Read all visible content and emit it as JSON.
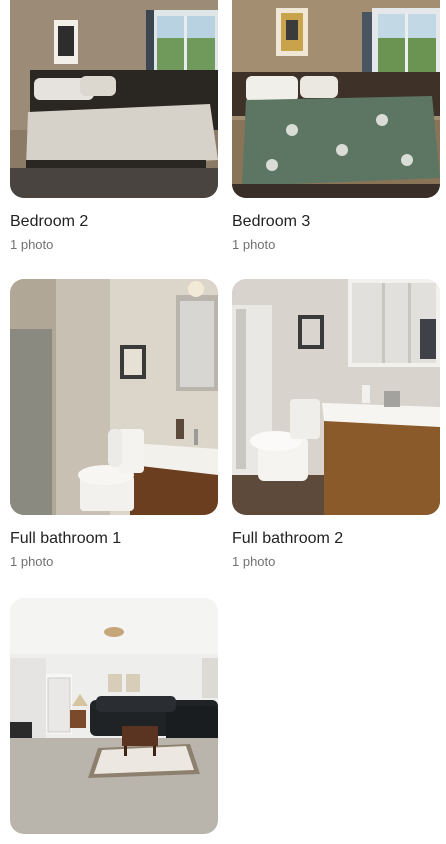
{
  "rooms": [
    {
      "title": "Bedroom 2",
      "count": "1 photo",
      "image": "bedroom-photo"
    },
    {
      "title": "Bedroom 3",
      "count": "1 photo",
      "image": "bedroom-photo"
    },
    {
      "title": "Full bathroom 1",
      "count": "1 photo",
      "image": "bathroom-photo"
    },
    {
      "title": "Full bathroom 2",
      "count": "1 photo",
      "image": "bathroom-photo"
    },
    {
      "title": "",
      "count": "",
      "image": "living-room-photo"
    }
  ]
}
